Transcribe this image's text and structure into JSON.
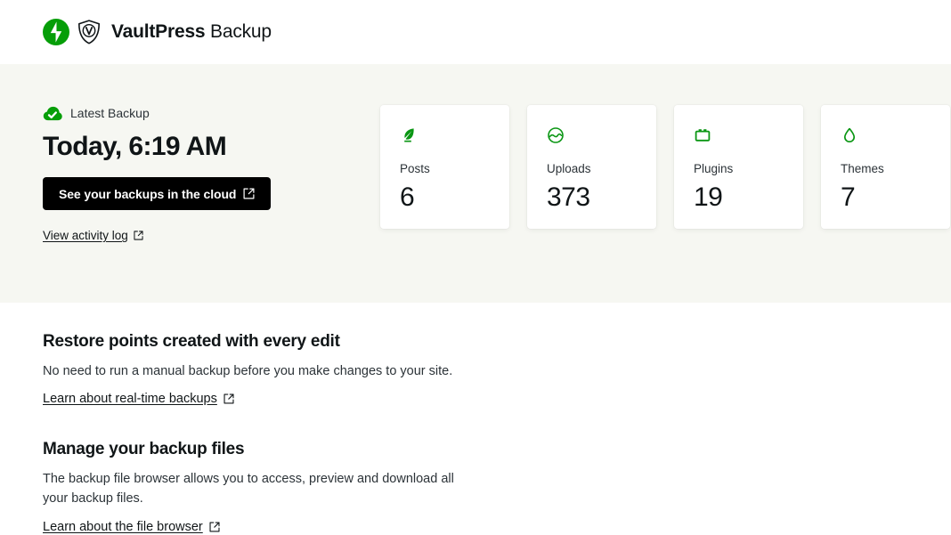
{
  "header": {
    "brand_strong": "VaultPress",
    "brand_light": "Backup",
    "jetpack_icon": "jetpack-logo-icon",
    "shield_icon": "vaultpress-shield-icon"
  },
  "hero": {
    "status_icon": "cloud-check-icon",
    "status_label": "Latest Backup",
    "backup_time": "Today, 6:19 AM",
    "cloud_button_label": "See your backups in the cloud",
    "cloud_button_icon": "external-link-icon",
    "activity_link_label": "View activity log",
    "activity_link_icon": "external-link-icon",
    "background_color": "#f6f7f2",
    "button_color": "#000000"
  },
  "stats": {
    "accent_color": "#0a9613",
    "cards": [
      {
        "icon": "quill-pen-icon",
        "label": "Posts",
        "value": "6"
      },
      {
        "icon": "media-image-icon",
        "label": "Uploads",
        "value": "373"
      },
      {
        "icon": "plugin-plug-icon",
        "label": "Plugins",
        "value": "19"
      },
      {
        "icon": "paint-droplet-icon",
        "label": "Themes",
        "value": "7"
      }
    ]
  },
  "sections": [
    {
      "title": "Restore points created with every edit",
      "body": "No need to run a manual backup before you make changes to your site.",
      "link_label": "Learn about real-time backups",
      "link_icon": "external-link-icon"
    },
    {
      "title": "Manage your backup files",
      "body": "The backup file browser allows you to access, preview and download all your backup files.",
      "link_label": "Learn about the file browser",
      "link_icon": "external-link-icon"
    }
  ]
}
